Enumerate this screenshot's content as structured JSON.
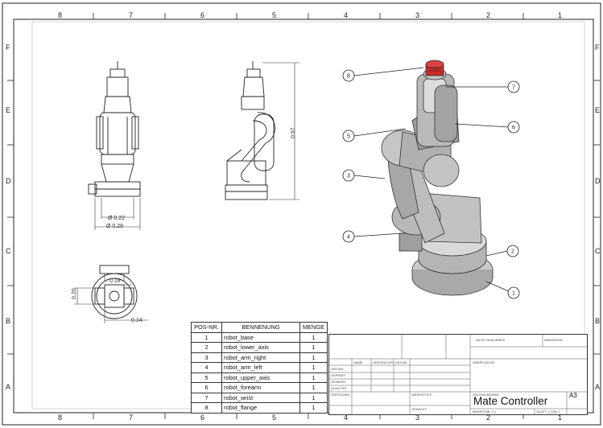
{
  "sheet": {
    "zones_cols": [
      "8",
      "7",
      "6",
      "5",
      "4",
      "3",
      "2",
      "1"
    ],
    "zones_rows": [
      "F",
      "E",
      "D",
      "C",
      "B",
      "A"
    ]
  },
  "dimensions": {
    "front_d1": "Ø 0.22",
    "front_d2": "Ø 0.28",
    "side_height": "0.97",
    "top_w": "0.18",
    "top_h": "0.20",
    "top_d": "0.14"
  },
  "balloons": [
    "1",
    "2",
    "3",
    "4",
    "5",
    "6",
    "7",
    "8"
  ],
  "bom": {
    "headers": [
      "POS-NR.",
      "BENNENUNG",
      "MENGE"
    ],
    "rows": [
      {
        "pos": "1",
        "name": "robot_base",
        "qty": "1"
      },
      {
        "pos": "2",
        "name": "robot_lower_axis",
        "qty": "1"
      },
      {
        "pos": "3",
        "name": "robot_arm_right",
        "qty": "1"
      },
      {
        "pos": "4",
        "name": "robot_arm_left",
        "qty": "1"
      },
      {
        "pos": "5",
        "name": "robot_upper_axis",
        "qty": "1"
      },
      {
        "pos": "6",
        "name": "robot_forearm",
        "qty": "1"
      },
      {
        "pos": "7",
        "name": "robot_wrist",
        "qty": "1"
      },
      {
        "pos": "8",
        "name": "robot_flange",
        "qty": "1"
      }
    ]
  },
  "title_block": {
    "title": "Mate Controller",
    "size": "A3",
    "row_labels": [
      "ZEICHN.",
      "GEPRÜFT",
      "GENEHM.",
      "QUALITÄT",
      "FERTIGUNG"
    ],
    "col_labels": [
      "NAME",
      "UNTERSCHR.",
      "DATUM"
    ],
    "material": "WERKSTOFF:",
    "weight": "GEWICHT:",
    "scale": "MASSSTAB: 1:1",
    "sheet": "BLATT 1 VON 1",
    "drawing_no": "ZEICHNUNGSNR.",
    "finish": "OBERFLÄCHE",
    "revision": "ÄNDERUNG",
    "note": "NICHT SKALIEREN"
  }
}
